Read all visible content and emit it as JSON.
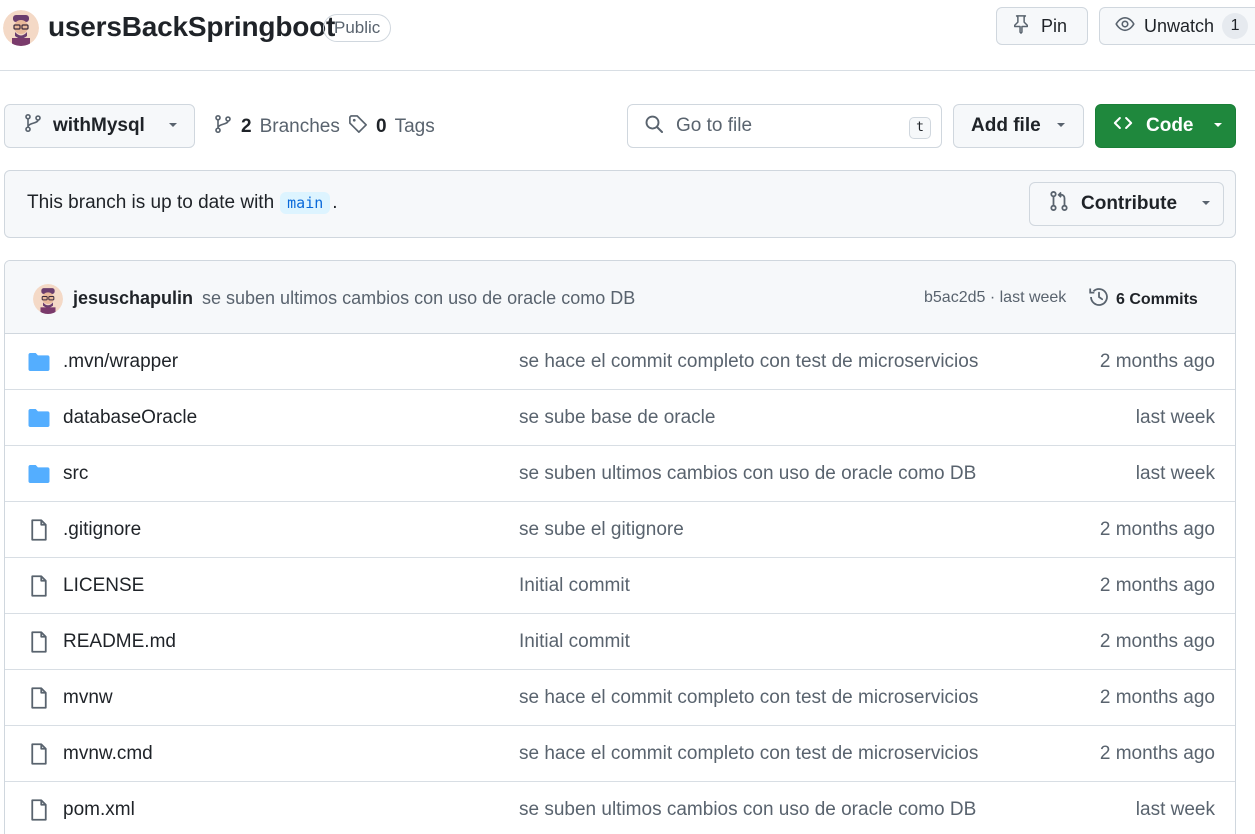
{
  "header": {
    "repo_name": "usersBackSpringboot",
    "visibility": "Public",
    "pin_label": "Pin",
    "unwatch_label": "Unwatch",
    "watch_count": "1"
  },
  "toolbar": {
    "branch": "withMysql",
    "branches_count": "2",
    "branches_label": "Branches",
    "tags_count": "0",
    "tags_label": "Tags",
    "search_placeholder": "Go to file",
    "search_shortcut": "t",
    "add_file_label": "Add file",
    "code_label": "Code"
  },
  "banner": {
    "text_before": "This branch is up to date with",
    "branch_ref": "main",
    "text_after": ".",
    "contribute_label": "Contribute"
  },
  "latest_commit": {
    "author": "jesuschapulin",
    "message": "se suben ultimos cambios con uso de oracle como DB",
    "hash_time": "b5ac2d5 · last week",
    "commits_label": "6 Commits"
  },
  "files": [
    {
      "name": ".mvn/wrapper",
      "type": "folder",
      "commit": "se hace el commit completo con test de microservicios",
      "age": "2 months ago"
    },
    {
      "name": "databaseOracle",
      "type": "folder",
      "commit": "se sube base de oracle",
      "age": "last week"
    },
    {
      "name": "src",
      "type": "folder",
      "commit": "se suben ultimos cambios con uso de oracle como DB",
      "age": "last week"
    },
    {
      "name": ".gitignore",
      "type": "file",
      "commit": "se sube el gitignore",
      "age": "2 months ago"
    },
    {
      "name": "LICENSE",
      "type": "file",
      "commit": "Initial commit",
      "age": "2 months ago"
    },
    {
      "name": "README.md",
      "type": "file",
      "commit": "Initial commit",
      "age": "2 months ago"
    },
    {
      "name": "mvnw",
      "type": "file",
      "commit": "se hace el commit completo con test de microservicios",
      "age": "2 months ago"
    },
    {
      "name": "mvnw.cmd",
      "type": "file",
      "commit": "se hace el commit completo con test de microservicios",
      "age": "2 months ago"
    },
    {
      "name": "pom.xml",
      "type": "file",
      "commit": "se suben ultimos cambios con uso de oracle como DB",
      "age": "last week"
    }
  ],
  "colors": {
    "accent_green": "#1f883d",
    "folder_blue": "#54aeff",
    "muted_text": "#59636e",
    "ref_chip_bg": "#ddf4ff",
    "ref_chip_fg": "#0969da"
  }
}
